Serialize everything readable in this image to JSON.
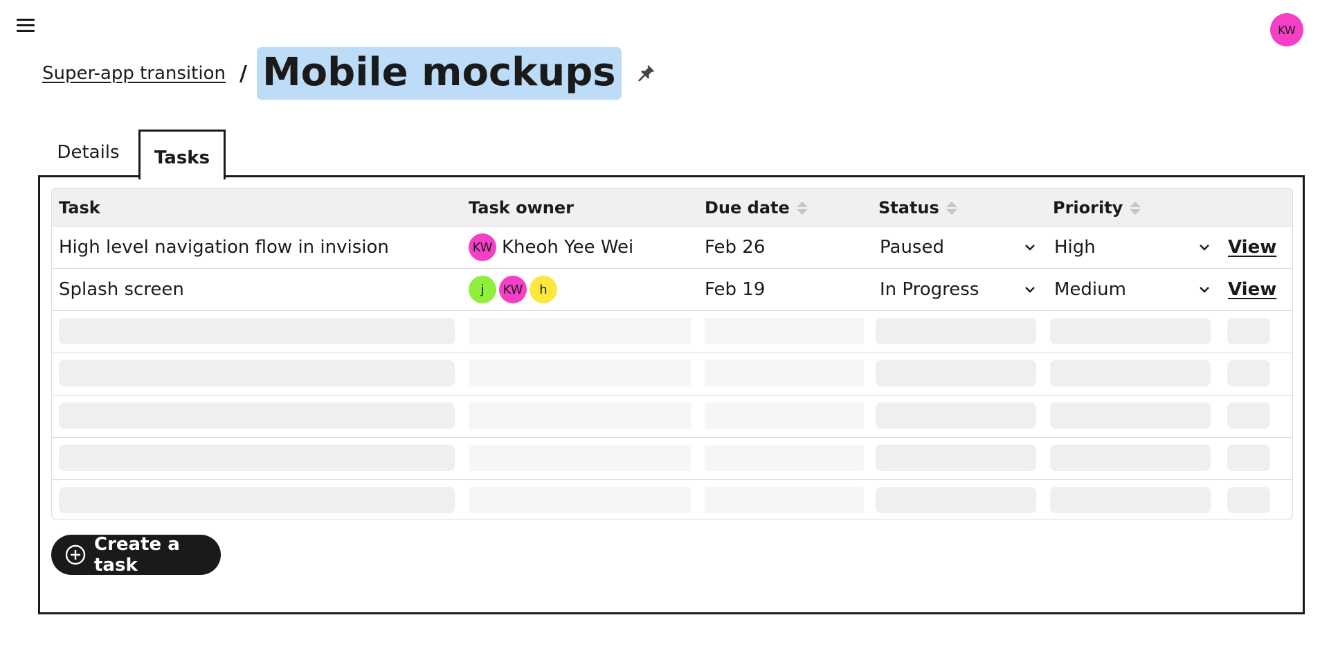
{
  "header": {
    "user_initials": "KW",
    "user_avatar_color": "#f53fc6"
  },
  "breadcrumb": {
    "parent": "Super-app transition",
    "separator": "/",
    "title": "Mobile mockups"
  },
  "tabs": [
    {
      "label": "Details",
      "active": false
    },
    {
      "label": "Tasks",
      "active": true
    }
  ],
  "table": {
    "columns": {
      "task": "Task",
      "owner": "Task owner",
      "due": "Due date",
      "status": "Status",
      "priority": "Priority"
    },
    "rows": [
      {
        "task": "High level navigation flow in invision",
        "owners": [
          {
            "initials": "KW",
            "color": "#f53fc6"
          }
        ],
        "owner_name": "Kheoh Yee Wei",
        "due": "Feb 26",
        "status": "Paused",
        "priority": "High",
        "action": "View"
      },
      {
        "task": "Splash screen",
        "owners": [
          {
            "initials": "j",
            "color": "#8ef03c"
          },
          {
            "initials": "KW",
            "color": "#f53fc6"
          },
          {
            "initials": "h",
            "color": "#fbe83e"
          }
        ],
        "due": "Feb 19",
        "status": "In Progress",
        "priority": "Medium",
        "action": "View"
      }
    ],
    "skeleton_rows": 5
  },
  "create_button": {
    "label": "Create a task"
  },
  "colors": {
    "title_highlight": "#bcdcf7",
    "header_bg": "#f0f0f0",
    "button_bg": "#1a1a1a"
  }
}
